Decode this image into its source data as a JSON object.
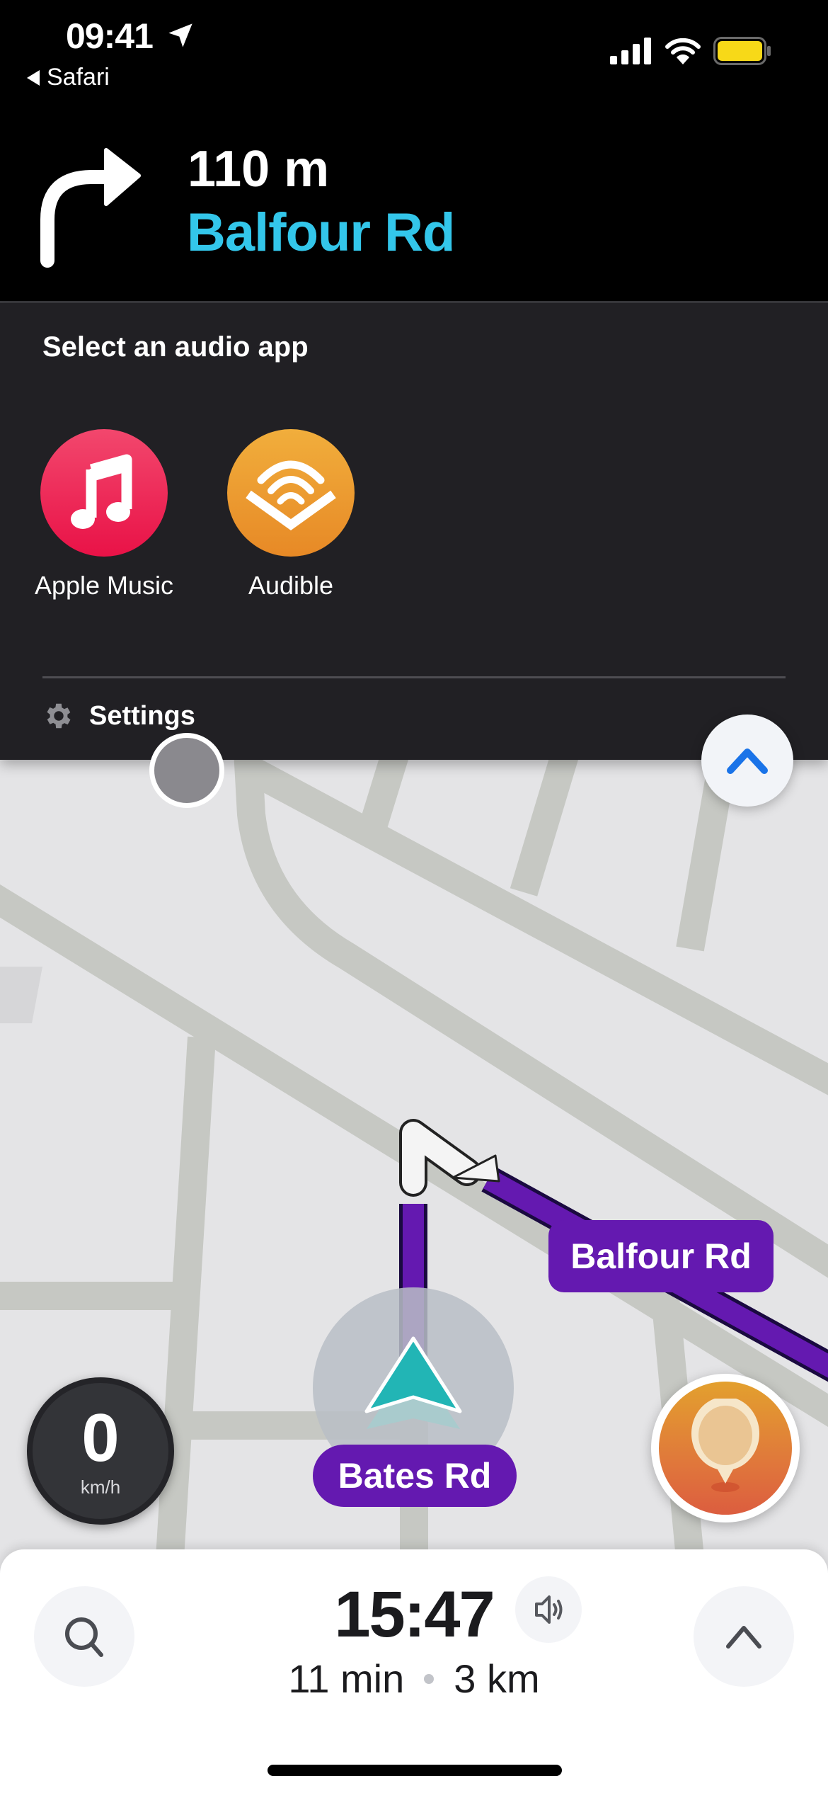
{
  "status_bar": {
    "time": "09:41",
    "back_app": "Safari",
    "icons": [
      "location-arrow-icon",
      "cellular-signal-icon",
      "wifi-icon",
      "battery-icon"
    ],
    "battery_color": "#f7d918"
  },
  "navigation": {
    "maneuver_icon": "turn-right-icon",
    "distance": "110 m",
    "street": "Balfour Rd",
    "street_color": "#33c6ea"
  },
  "audio_panel": {
    "title": "Select an audio app",
    "apps": [
      {
        "name": "Apple Music",
        "icon": "music-note-icon",
        "color": "#ec2a55"
      },
      {
        "name": "Audible",
        "icon": "audible-icon",
        "color": "#ed9a2a"
      }
    ],
    "settings_label": "Settings"
  },
  "map": {
    "route_color": "#6419b0",
    "road_labels": [
      "Balfour Rd",
      "Bates Rd"
    ],
    "speed": {
      "value": "0",
      "unit": "km/h"
    }
  },
  "trip": {
    "eta": "15:47",
    "duration": "11 min",
    "distance": "3 km"
  }
}
